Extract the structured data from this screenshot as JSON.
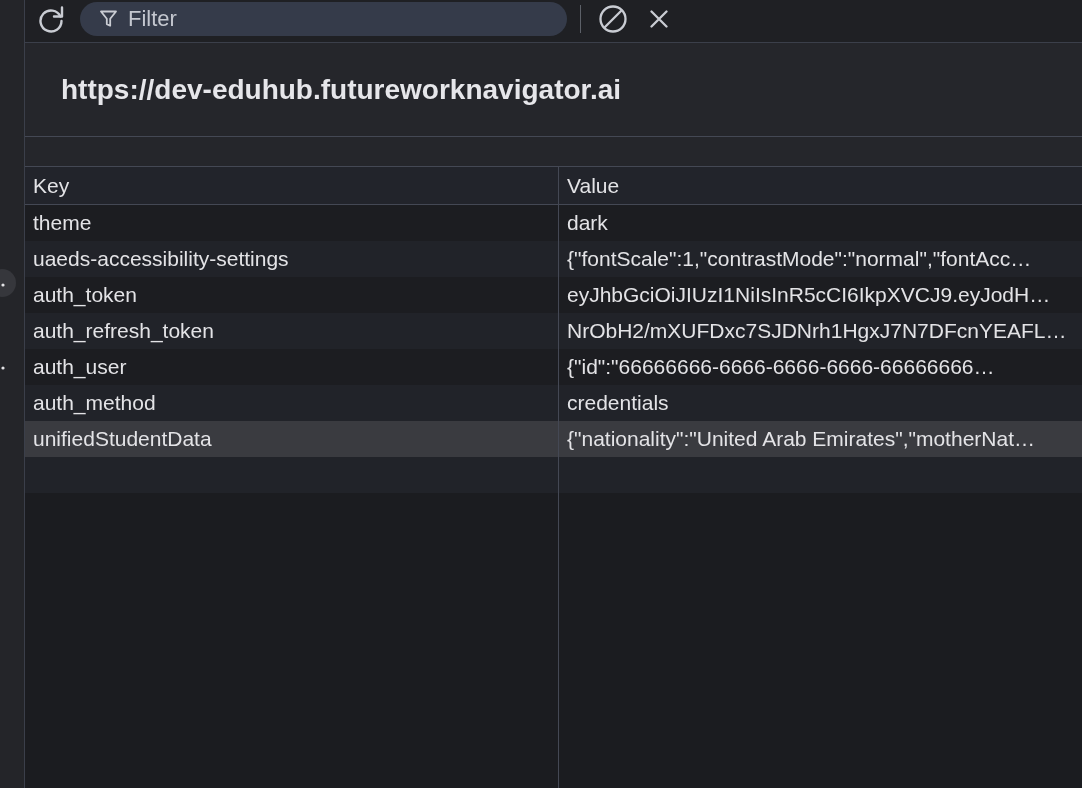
{
  "toolbar": {
    "filter": {
      "placeholder": "Filter"
    }
  },
  "origin": "https://dev-eduhub.futureworknavigator.ai",
  "table": {
    "columns": [
      "Key",
      "Value"
    ],
    "rows": [
      {
        "key": "theme",
        "value": "dark",
        "selected": false
      },
      {
        "key": "uaeds-accessibility-settings",
        "value": "{\"fontScale\":1,\"contrastMode\":\"normal\",\"fontAcc…",
        "selected": false
      },
      {
        "key": "auth_token",
        "value": "eyJhbGciOiJIUzI1NiIsInR5cCI6IkpXVCJ9.eyJodH…",
        "selected": false
      },
      {
        "key": "auth_refresh_token",
        "value": "NrObH2/mXUFDxc7SJDNrh1HgxJ7N7DFcnYEAFL…",
        "selected": false
      },
      {
        "key": "auth_user",
        "value": "{\"id\":\"66666666-6666-6666-6666-66666666…",
        "selected": false
      },
      {
        "key": "auth_method",
        "value": "credentials",
        "selected": false
      },
      {
        "key": "unifiedStudentData",
        "value": "{\"nationality\":\"United Arab Emirates\",\"motherNat…",
        "selected": true
      }
    ]
  }
}
